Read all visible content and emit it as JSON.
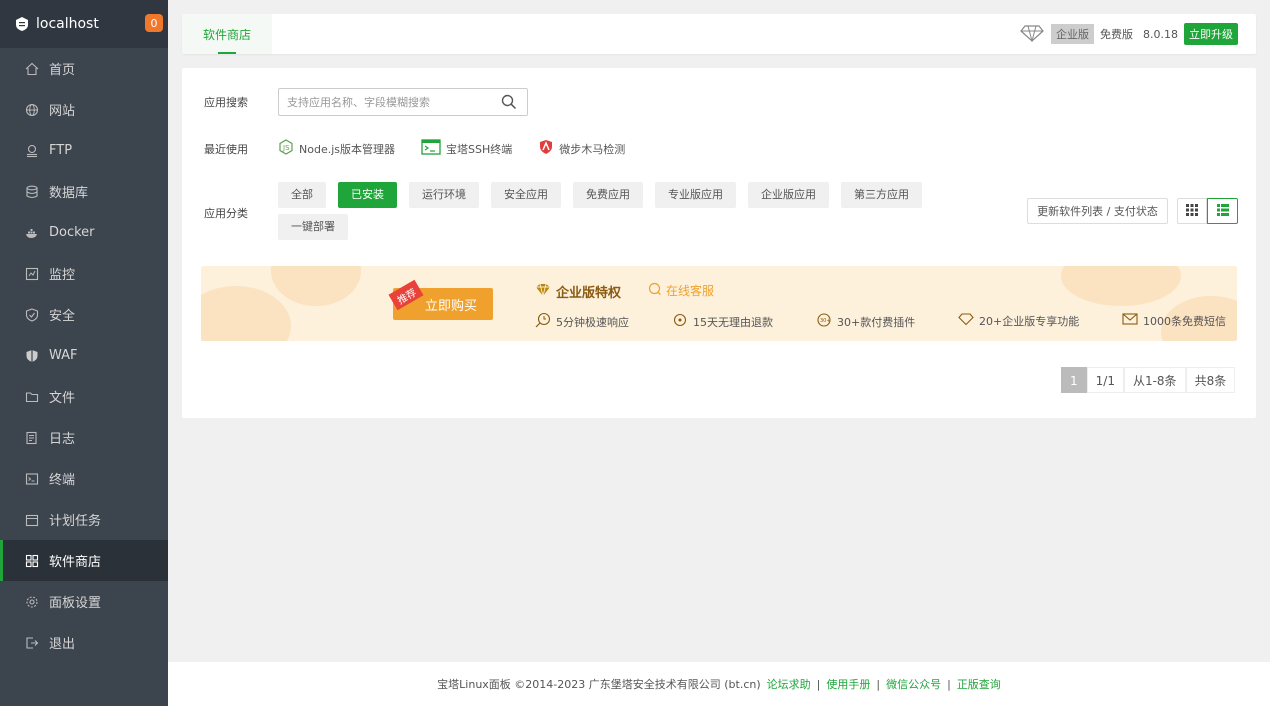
{
  "sidebar": {
    "host": "localhost",
    "badge": "0",
    "items": [
      {
        "label": "首页",
        "icon": "home-icon"
      },
      {
        "label": "网站",
        "icon": "globe-icon"
      },
      {
        "label": "FTP",
        "icon": "ftp-icon"
      },
      {
        "label": "数据库",
        "icon": "database-icon"
      },
      {
        "label": "Docker",
        "icon": "docker-icon"
      },
      {
        "label": "监控",
        "icon": "monitor-icon"
      },
      {
        "label": "安全",
        "icon": "shield-icon"
      },
      {
        "label": "WAF",
        "icon": "waf-icon"
      },
      {
        "label": "文件",
        "icon": "folder-icon"
      },
      {
        "label": "日志",
        "icon": "log-icon"
      },
      {
        "label": "终端",
        "icon": "terminal-icon"
      },
      {
        "label": "计划任务",
        "icon": "calendar-icon"
      },
      {
        "label": "软件商店",
        "icon": "grid-icon"
      },
      {
        "label": "面板设置",
        "icon": "gear-icon"
      },
      {
        "label": "退出",
        "icon": "logout-icon"
      }
    ]
  },
  "topbar": {
    "tab": "软件商店",
    "enterprise": "企业版",
    "free": "免费版",
    "version": "8.0.18",
    "upgrade": "立即升级"
  },
  "search": {
    "label": "应用搜索",
    "placeholder": "支持应用名称、字段模糊搜索"
  },
  "recent": {
    "label": "最近使用",
    "items": [
      "Node.js版本管理器",
      "宝塔SSH终端",
      "微步木马检测"
    ]
  },
  "category": {
    "label": "应用分类",
    "items": [
      "全部",
      "已安装",
      "运行环境",
      "安全应用",
      "免费应用",
      "专业版应用",
      "企业版应用",
      "第三方应用",
      "一键部署"
    ],
    "active_index": 1,
    "refresh": "更新软件列表 / 支付状态"
  },
  "banner": {
    "tag": "推荐",
    "buy": "立即购买",
    "title": "企业版特权",
    "online": "在线客服",
    "features": [
      "5分钟极速响应",
      "15天无理由退款",
      "30+款付费插件",
      "20+企业版专享功能",
      "1000条免费短信"
    ]
  },
  "pager": {
    "current": "1",
    "pages": "1/1",
    "range": "从1-8条",
    "total": "共8条"
  },
  "footer": {
    "copyright": "宝塔Linux面板 ©2014-2023 广东堡塔安全技术有限公司 (bt.cn)",
    "links": [
      "论坛求助",
      "使用手册",
      "微信公众号",
      "正版查询"
    ]
  },
  "colors": {
    "accent": "#20a53a",
    "sidebar": "#3c444d",
    "banner": "#fdf1dc",
    "orange": "#f0a12d"
  }
}
